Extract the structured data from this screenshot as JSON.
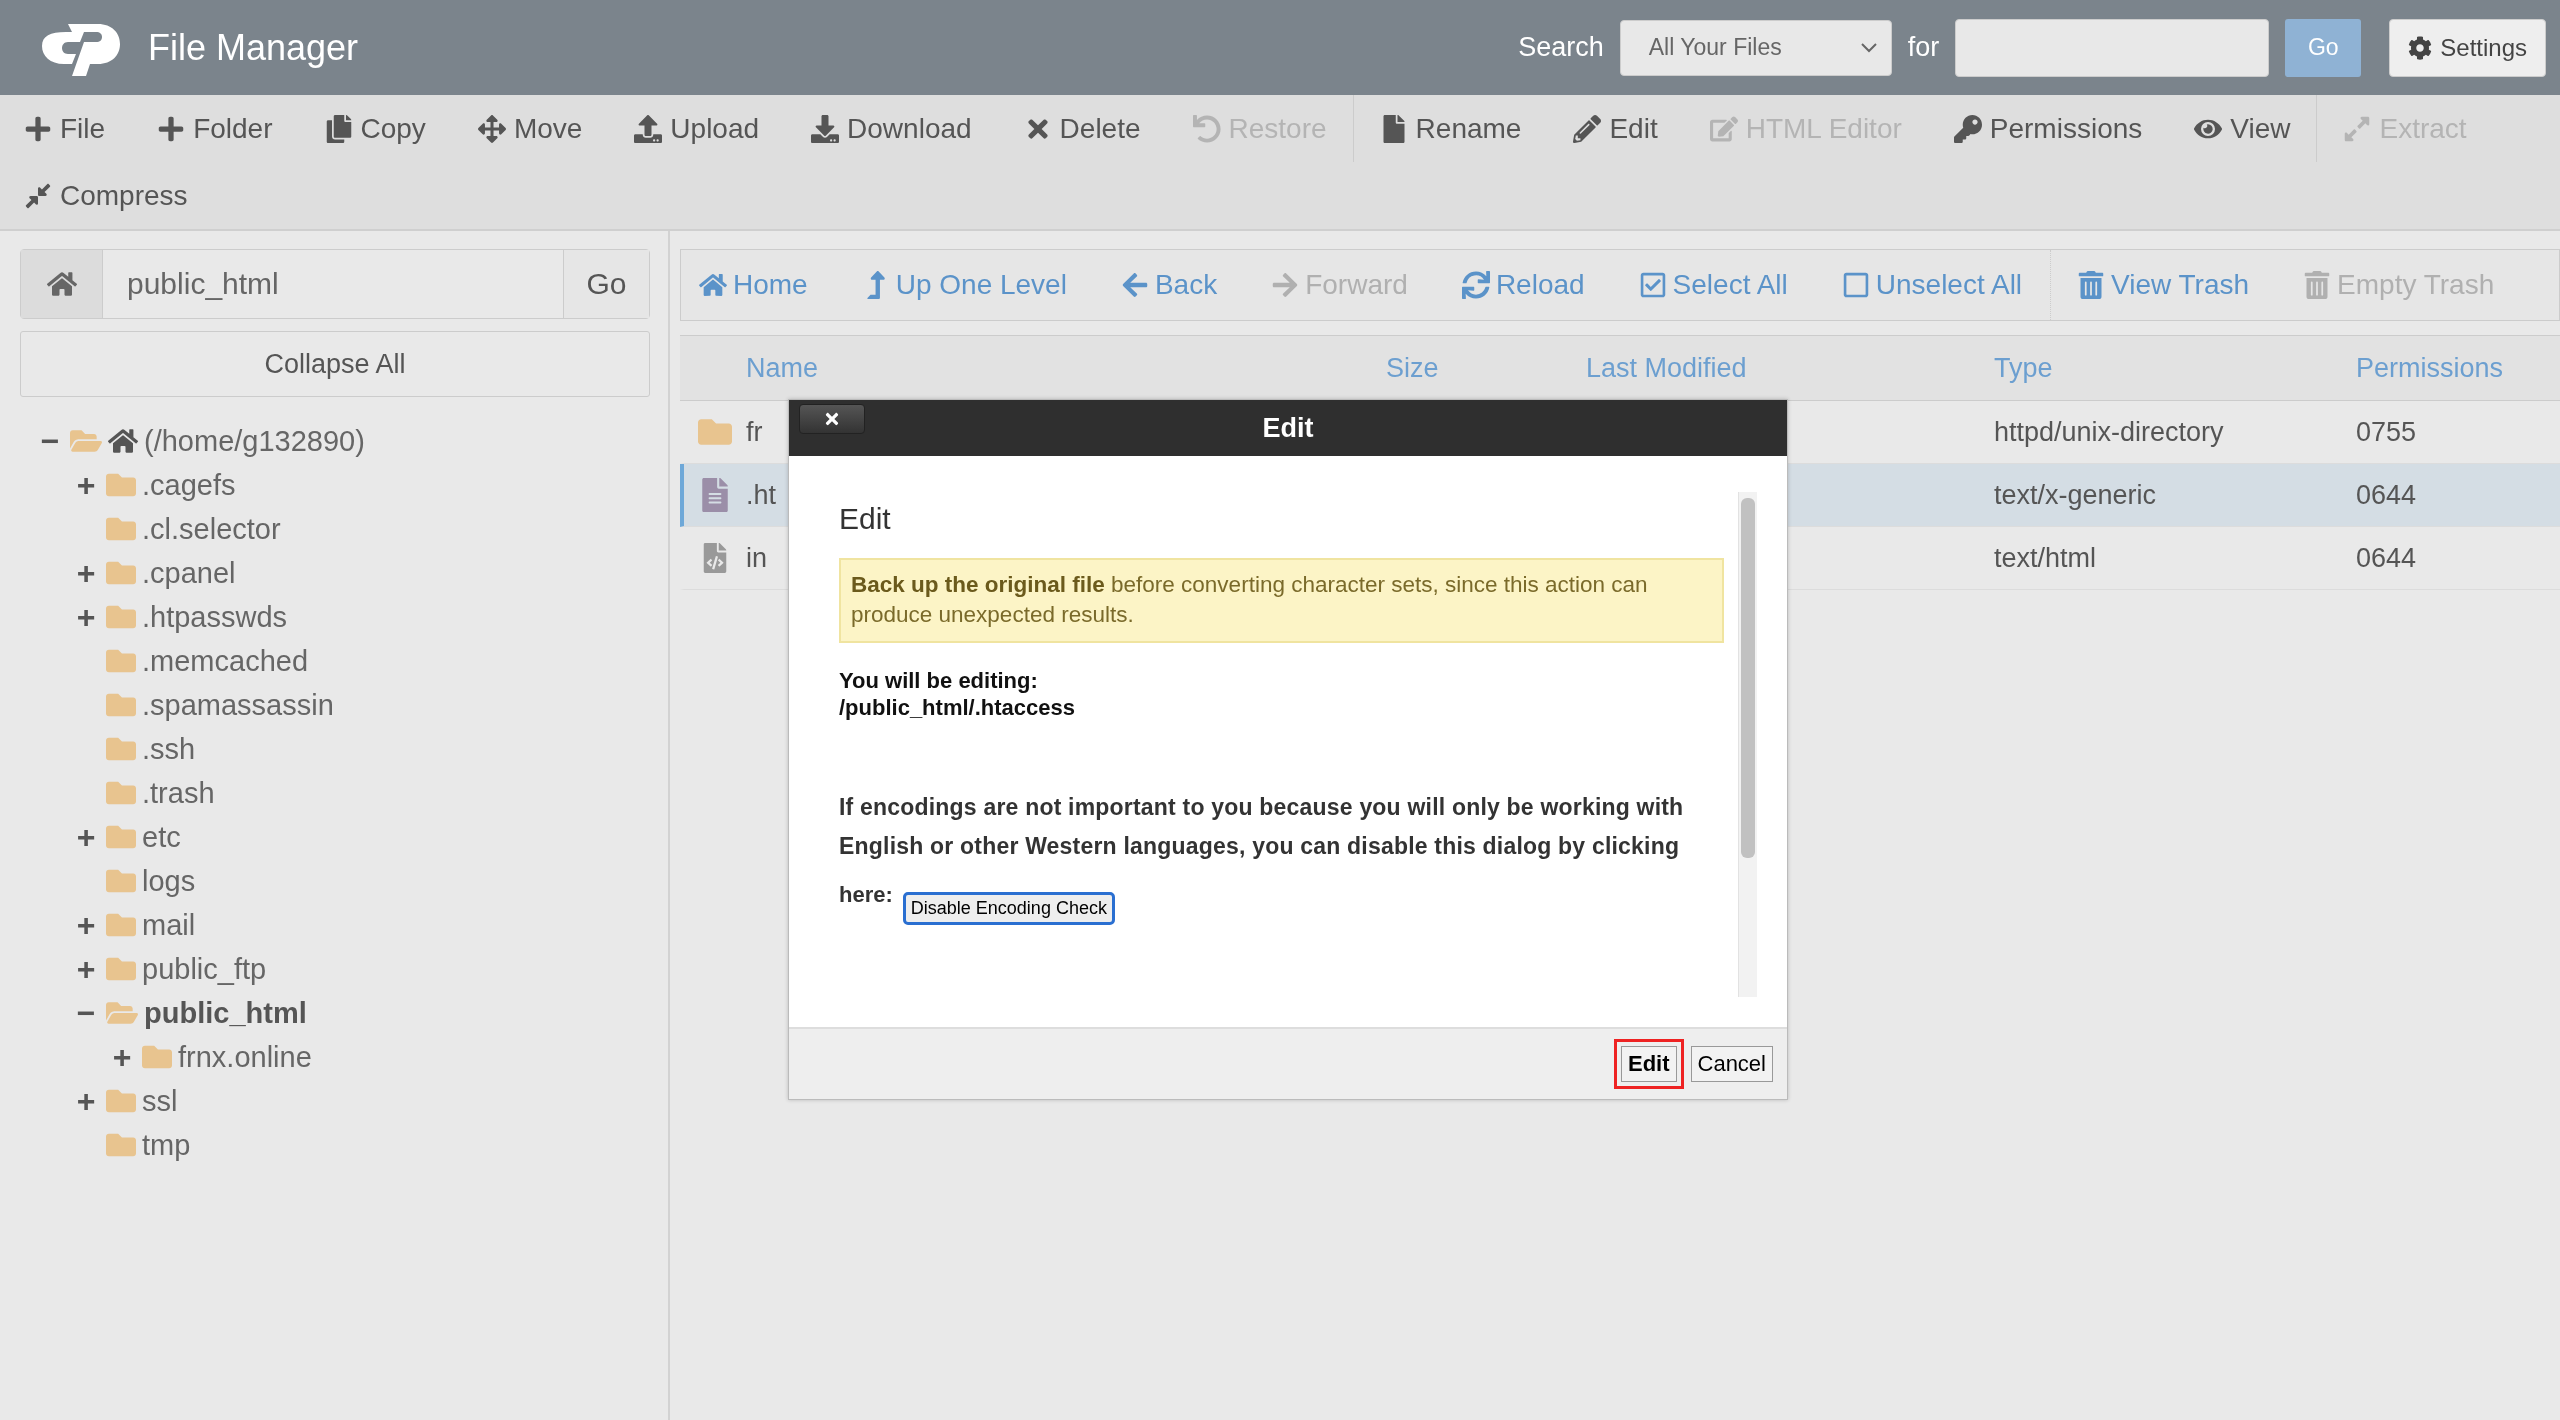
{
  "header": {
    "title": "File Manager",
    "search_label": "Search",
    "search_scope": "All Your Files",
    "for_label": "for",
    "go": "Go",
    "settings": "Settings"
  },
  "toolbar": [
    {
      "label": "File",
      "kind": "plus",
      "disabled": false
    },
    {
      "label": "Folder",
      "kind": "plus",
      "disabled": false
    },
    {
      "label": "Copy",
      "kind": "copy",
      "disabled": false
    },
    {
      "label": "Move",
      "kind": "move",
      "disabled": false
    },
    {
      "label": "Upload",
      "kind": "upload",
      "disabled": false
    },
    {
      "label": "Download",
      "kind": "download",
      "disabled": false
    },
    {
      "label": "Delete",
      "kind": "delete",
      "disabled": false
    },
    {
      "label": "Restore",
      "kind": "undo",
      "disabled": true
    },
    {
      "label": "Rename",
      "kind": "file",
      "disabled": false
    },
    {
      "label": "Edit",
      "kind": "pencil",
      "disabled": false
    },
    {
      "label": "HTML Editor",
      "kind": "edit",
      "disabled": true
    },
    {
      "label": "Permissions",
      "kind": "key",
      "disabled": false
    },
    {
      "label": "View",
      "kind": "eye",
      "disabled": false
    },
    {
      "label": "Extract",
      "kind": "expand",
      "disabled": true
    },
    {
      "label": "Compress",
      "kind": "compress",
      "disabled": false
    }
  ],
  "path": {
    "value": "public_html",
    "go": "Go"
  },
  "collapse_all": "Collapse All",
  "tree": [
    {
      "label": "(/home/g132890)",
      "home": true,
      "toggle": "−",
      "expanded": true,
      "selected": false,
      "children": [
        {
          "label": ".cagefs",
          "toggle": "+",
          "expanded": false,
          "selected": false
        },
        {
          "label": ".cl.selector",
          "expanded": false,
          "selected": false
        },
        {
          "label": ".cpanel",
          "toggle": "+",
          "expanded": false,
          "selected": false
        },
        {
          "label": ".htpasswds",
          "toggle": "+",
          "expanded": false,
          "selected": false
        },
        {
          "label": ".memcached",
          "expanded": false,
          "selected": false
        },
        {
          "label": ".spamassassin",
          "expanded": false,
          "selected": false
        },
        {
          "label": ".ssh",
          "expanded": false,
          "selected": false
        },
        {
          "label": ".trash",
          "expanded": false,
          "selected": false
        },
        {
          "label": "etc",
          "toggle": "+",
          "expanded": false,
          "selected": false
        },
        {
          "label": "logs",
          "expanded": false,
          "selected": false
        },
        {
          "label": "mail",
          "toggle": "+",
          "expanded": false,
          "selected": false
        },
        {
          "label": "public_ftp",
          "toggle": "+",
          "expanded": false,
          "selected": false
        },
        {
          "label": "public_html",
          "toggle": "−",
          "expanded": true,
          "selected": true,
          "children": [
            {
              "label": "frnx.online",
              "toggle": "+",
              "expanded": false,
              "selected": false
            }
          ]
        },
        {
          "label": "ssl",
          "toggle": "+",
          "expanded": false,
          "selected": false
        },
        {
          "label": "tmp",
          "expanded": false,
          "selected": false
        }
      ]
    }
  ],
  "nav": [
    {
      "label": "Home",
      "kind": "home",
      "disabled": false
    },
    {
      "label": "Up One Level",
      "kind": "up",
      "disabled": false
    },
    {
      "label": "Back",
      "kind": "left",
      "disabled": false
    },
    {
      "label": "Forward",
      "kind": "right",
      "disabled": true
    },
    {
      "label": "Reload",
      "kind": "reload",
      "disabled": false
    },
    {
      "label": "Select All",
      "kind": "checked",
      "disabled": false
    },
    {
      "label": "Unselect All",
      "kind": "unchecked",
      "disabled": false
    },
    {
      "label": "View Trash",
      "kind": "trash",
      "disabled": false
    },
    {
      "label": "Empty Trash",
      "kind": "trash",
      "disabled": true
    }
  ],
  "table": {
    "columns": [
      "Name",
      "Size",
      "Last Modified",
      "Type",
      "Permissions"
    ],
    "rows": [
      {
        "kind": "folder",
        "name": "fr",
        "type": "httpd/unix-directory",
        "permissions": "0755",
        "selected": false
      },
      {
        "kind": "text",
        "name": ".ht",
        "type": "text/x-generic",
        "permissions": "0644",
        "selected": true
      },
      {
        "kind": "code",
        "name": "in",
        "type": "text/html",
        "permissions": "0644",
        "selected": false
      }
    ]
  },
  "dialog": {
    "title": "Edit",
    "heading": "Edit",
    "warning": "**Back up the original file** before converting character sets, since this action can produce unexpected results.",
    "editing_label": "You will be editing:",
    "editing_path": "/public_html/.htaccess",
    "notice": "If encodings are not important to you because you will only be working with English or other Western languages, you can disable this dialog by clicking",
    "here_label": "here:",
    "disable_button": "Disable Encoding Check",
    "buttons": [
      {
        "label": "Edit",
        "focused": true
      },
      {
        "label": "Cancel",
        "focused": false
      }
    ]
  }
}
